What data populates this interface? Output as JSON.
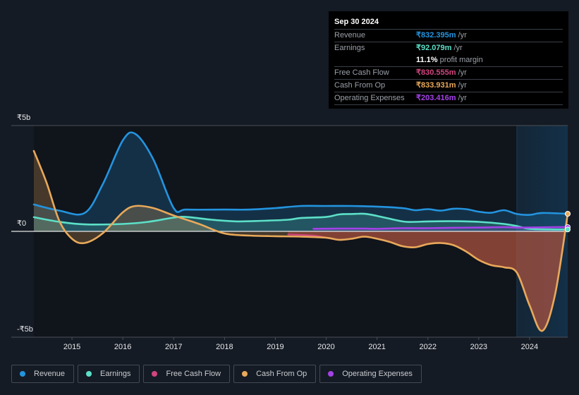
{
  "tooltip": {
    "date": "Sep 30 2024",
    "rows": [
      {
        "label": "Revenue",
        "value": "₹832.395m",
        "unit": "/yr",
        "color": "#2394df"
      },
      {
        "label": "Earnings",
        "value": "₹92.079m",
        "unit": "/yr",
        "color": "#5ce0c8"
      },
      {
        "label": "",
        "value": "11.1%",
        "unit": "profit margin",
        "color": "#ffffff"
      },
      {
        "label": "Free Cash Flow",
        "value": "₹830.555m",
        "unit": "/yr",
        "color": "#d0467e"
      },
      {
        "label": "Cash From Op",
        "value": "₹833.931m",
        "unit": "/yr",
        "color": "#e8a95a"
      },
      {
        "label": "Operating Expenses",
        "value": "₹203.416m",
        "unit": "/yr",
        "color": "#a442e8"
      }
    ]
  },
  "legend": [
    {
      "label": "Revenue",
      "color": "#2394df"
    },
    {
      "label": "Earnings",
      "color": "#5ce0c8"
    },
    {
      "label": "Free Cash Flow",
      "color": "#d0467e"
    },
    {
      "label": "Cash From Op",
      "color": "#e8a95a"
    },
    {
      "label": "Operating Expenses",
      "color": "#a442e8"
    }
  ],
  "chart_data": {
    "type": "area",
    "title": "",
    "xlabel": "",
    "ylabel": "",
    "y_unit": "₹ billions",
    "ylim": [
      -5,
      5
    ],
    "xlim": [
      2014.25,
      2024.75
    ],
    "y_ticks": [
      {
        "value": 5,
        "label": "₹5b"
      },
      {
        "value": 0,
        "label": "₹0"
      },
      {
        "value": -5,
        "label": "-₹5b"
      }
    ],
    "x_ticks": [
      2015,
      2016,
      2017,
      2018,
      2019,
      2020,
      2021,
      2022,
      2023,
      2024
    ],
    "x_tick_labels": [
      "2015",
      "2016",
      "2017",
      "2018",
      "2019",
      "2020",
      "2021",
      "2022",
      "2023",
      "2024"
    ],
    "highlight_range": [
      2023.75,
      2024.75
    ],
    "grid": false,
    "legend_position": "bottom",
    "series": [
      {
        "name": "Revenue",
        "color": "#2394df",
        "points": [
          [
            2014.25,
            1.27
          ],
          [
            2014.75,
            0.98
          ],
          [
            2015.25,
            0.87
          ],
          [
            2015.6,
            2.2
          ],
          [
            2016.0,
            4.3
          ],
          [
            2016.25,
            4.6
          ],
          [
            2016.6,
            3.4
          ],
          [
            2017.0,
            1.1
          ],
          [
            2017.25,
            1.03
          ],
          [
            2018.0,
            1.03
          ],
          [
            2018.5,
            1.03
          ],
          [
            2019.0,
            1.1
          ],
          [
            2019.5,
            1.2
          ],
          [
            2020.0,
            1.2
          ],
          [
            2020.5,
            1.2
          ],
          [
            2021.0,
            1.17
          ],
          [
            2021.5,
            1.1
          ],
          [
            2021.75,
            1.0
          ],
          [
            2022.0,
            1.05
          ],
          [
            2022.25,
            0.98
          ],
          [
            2022.5,
            1.07
          ],
          [
            2022.75,
            1.05
          ],
          [
            2023.0,
            0.93
          ],
          [
            2023.25,
            0.88
          ],
          [
            2023.5,
            1.0
          ],
          [
            2023.75,
            0.82
          ],
          [
            2024.0,
            0.78
          ],
          [
            2024.25,
            0.87
          ],
          [
            2024.75,
            0.83
          ]
        ]
      },
      {
        "name": "Earnings",
        "color": "#5ce0c8",
        "points": [
          [
            2014.25,
            0.67
          ],
          [
            2014.75,
            0.45
          ],
          [
            2015.25,
            0.33
          ],
          [
            2016.0,
            0.35
          ],
          [
            2016.5,
            0.45
          ],
          [
            2017.0,
            0.65
          ],
          [
            2017.25,
            0.68
          ],
          [
            2017.75,
            0.55
          ],
          [
            2018.25,
            0.47
          ],
          [
            2018.75,
            0.5
          ],
          [
            2019.25,
            0.55
          ],
          [
            2019.5,
            0.63
          ],
          [
            2020.0,
            0.68
          ],
          [
            2020.25,
            0.8
          ],
          [
            2020.5,
            0.82
          ],
          [
            2020.75,
            0.83
          ],
          [
            2021.0,
            0.73
          ],
          [
            2021.5,
            0.47
          ],
          [
            2021.75,
            0.45
          ],
          [
            2022.0,
            0.47
          ],
          [
            2022.5,
            0.48
          ],
          [
            2023.0,
            0.45
          ],
          [
            2023.5,
            0.35
          ],
          [
            2023.75,
            0.25
          ],
          [
            2024.0,
            0.12
          ],
          [
            2024.5,
            0.09
          ],
          [
            2024.75,
            0.09
          ]
        ]
      },
      {
        "name": "Free Cash Flow",
        "color": "#d0467e",
        "points": [
          [
            2019.25,
            -0.15
          ],
          [
            2019.75,
            -0.2
          ],
          [
            2020.0,
            -0.3
          ],
          [
            2020.25,
            -0.4
          ],
          [
            2020.5,
            -0.35
          ],
          [
            2020.75,
            -0.25
          ],
          [
            2021.0,
            -0.35
          ],
          [
            2021.25,
            -0.5
          ],
          [
            2021.5,
            -0.7
          ],
          [
            2021.75,
            -0.75
          ],
          [
            2022.0,
            -0.6
          ],
          [
            2022.25,
            -0.55
          ],
          [
            2022.5,
            -0.65
          ],
          [
            2022.75,
            -0.95
          ],
          [
            2023.0,
            -1.35
          ],
          [
            2023.25,
            -1.6
          ],
          [
            2023.5,
            -1.7
          ],
          [
            2023.75,
            -1.95
          ],
          [
            2024.0,
            -3.5
          ],
          [
            2024.25,
            -4.7
          ],
          [
            2024.5,
            -3.0
          ],
          [
            2024.75,
            0.83
          ]
        ]
      },
      {
        "name": "Cash From Op",
        "color": "#e8a95a",
        "points": [
          [
            2014.25,
            3.8
          ],
          [
            2014.5,
            2.3
          ],
          [
            2014.75,
            0.5
          ],
          [
            2015.0,
            -0.35
          ],
          [
            2015.25,
            -0.55
          ],
          [
            2015.6,
            -0.1
          ],
          [
            2016.0,
            0.9
          ],
          [
            2016.25,
            1.2
          ],
          [
            2016.6,
            1.1
          ],
          [
            2017.0,
            0.75
          ],
          [
            2017.5,
            0.35
          ],
          [
            2018.0,
            -0.1
          ],
          [
            2018.5,
            -0.2
          ],
          [
            2019.0,
            -0.23
          ],
          [
            2019.5,
            -0.25
          ],
          [
            2020.0,
            -0.3
          ],
          [
            2020.25,
            -0.4
          ],
          [
            2020.5,
            -0.35
          ],
          [
            2020.75,
            -0.25
          ],
          [
            2021.0,
            -0.35
          ],
          [
            2021.25,
            -0.5
          ],
          [
            2021.5,
            -0.7
          ],
          [
            2021.75,
            -0.75
          ],
          [
            2022.0,
            -0.6
          ],
          [
            2022.25,
            -0.55
          ],
          [
            2022.5,
            -0.65
          ],
          [
            2022.75,
            -0.95
          ],
          [
            2023.0,
            -1.35
          ],
          [
            2023.25,
            -1.6
          ],
          [
            2023.5,
            -1.7
          ],
          [
            2023.75,
            -1.95
          ],
          [
            2024.0,
            -3.5
          ],
          [
            2024.25,
            -4.7
          ],
          [
            2024.5,
            -3.0
          ],
          [
            2024.75,
            0.83
          ]
        ]
      },
      {
        "name": "Operating Expenses",
        "color": "#a442e8",
        "points": [
          [
            2019.75,
            0.12
          ],
          [
            2020.25,
            0.13
          ],
          [
            2020.75,
            0.13
          ],
          [
            2021.0,
            0.12
          ],
          [
            2021.5,
            0.15
          ],
          [
            2022.0,
            0.15
          ],
          [
            2022.5,
            0.17
          ],
          [
            2023.0,
            0.18
          ],
          [
            2023.5,
            0.2
          ],
          [
            2023.75,
            0.18
          ],
          [
            2024.0,
            0.18
          ],
          [
            2024.5,
            0.2
          ],
          [
            2024.75,
            0.2
          ]
        ]
      }
    ]
  }
}
